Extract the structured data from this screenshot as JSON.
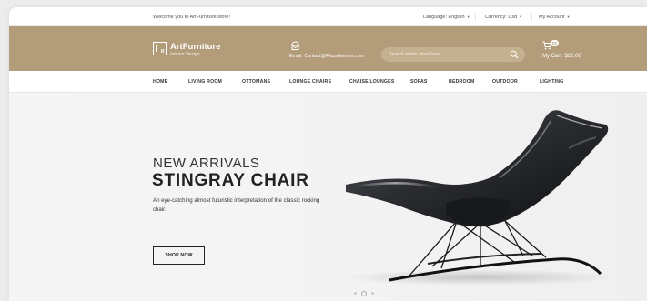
{
  "topbar": {
    "welcome": "Welcome you to ArtFurniture store!",
    "language": "Language: English",
    "currency": "Currency: Usd",
    "account": "My Account"
  },
  "header": {
    "brand": "ArtFurniture",
    "tagline": "Interior Design",
    "email": "Email: Contact@Plazathemes.com",
    "search_placeholder": "Search entire store here...",
    "cart_count": "02",
    "cart_label": "My Cart: $22.00"
  },
  "nav": {
    "items": [
      "HOME",
      "LIVING ROOM",
      "OTTOMANS",
      "LOUNGE CHAIRS",
      "CHAISE LOUNGES",
      "SOFAS",
      "BEDROOM",
      "OUTDOOR",
      "LIGHTING"
    ]
  },
  "hero": {
    "kicker": "NEW ARRIVALS",
    "title": "STINGRAY CHAIR",
    "description": "An eye-catching almost futuristic interpretation of the classic rocking chair.",
    "cta": "SHOP NOW",
    "slide_count": 3,
    "active_slide": 2
  },
  "colors": {
    "brand_band": "#b39c79",
    "text_dark": "#222222"
  },
  "icons": {
    "email": "envelope-icon",
    "search": "search-icon",
    "cart": "cart-icon",
    "logo": "logo-frame-icon"
  }
}
